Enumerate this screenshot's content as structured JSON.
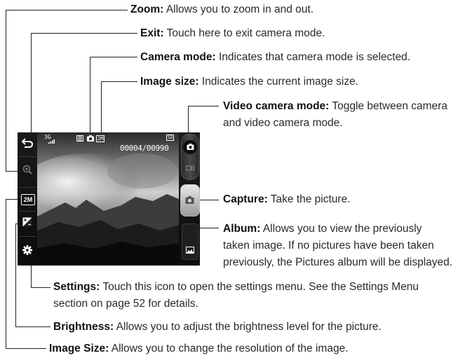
{
  "callouts": [
    {
      "id": "zoom",
      "title": "Zoom:",
      "desc": "Allows you to zoom in and out."
    },
    {
      "id": "exit",
      "title": "Exit:",
      "desc": "Touch here to exit camera mode."
    },
    {
      "id": "camera_mode",
      "title": "Camera mode:",
      "desc": "Indicates that camera mode is selected."
    },
    {
      "id": "image_size_indicator",
      "title": "Image size:",
      "desc": "Indicates the current image size."
    },
    {
      "id": "video_mode",
      "title": "Video camera mode:",
      "desc": "Toggle between camera",
      "desc2": "and video camera mode."
    },
    {
      "id": "capture",
      "title": "Capture:",
      "desc": "Take the picture."
    },
    {
      "id": "album",
      "title": "Album:",
      "desc": "Allows you to view the previously",
      "desc2": "taken image. If no pictures have been taken",
      "desc3": "previously, the Pictures album will be displayed."
    },
    {
      "id": "settings",
      "title": "Settings:",
      "desc": "Touch this icon to open the settings menu. See the Settings Menu",
      "desc2": "section on page 52 for details."
    },
    {
      "id": "brightness",
      "title": "Brightness:",
      "desc": "Allows you to adjust the brightness level for the picture."
    },
    {
      "id": "image_size",
      "title": "Image Size:",
      "desc": "Allows you to change the resolution of the image."
    }
  ],
  "screen": {
    "counter": "00004/00990",
    "size_badge": "2M",
    "network": "3G",
    "storage": "SD"
  }
}
